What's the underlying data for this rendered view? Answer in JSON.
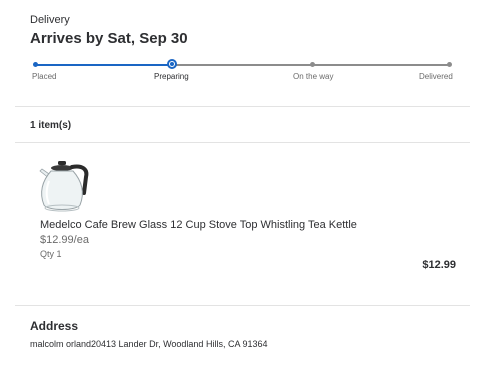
{
  "delivery": {
    "label": "Delivery",
    "arrives": "Arrives by Sat, Sep 30"
  },
  "tracker": {
    "current_step": "Preparing",
    "steps": [
      {
        "label": "Placed"
      },
      {
        "label": "Preparing"
      },
      {
        "label": "On the way"
      },
      {
        "label": "Delivered"
      }
    ],
    "accent_color": "#1a66c4",
    "inactive_color": "#8c8c8c"
  },
  "items": {
    "count_label": "1 item(s)",
    "list": [
      {
        "name": "Medelco Cafe Brew Glass 12 Cup Stove Top Whistling Tea Kettle",
        "unit_price": "$12.99/ea",
        "qty": "Qty 1",
        "total": "$12.99",
        "image": "glass-tea-kettle"
      }
    ]
  },
  "address": {
    "heading": "Address",
    "text": "malcolm orland20413 Lander Dr, Woodland Hills, CA 91364"
  }
}
